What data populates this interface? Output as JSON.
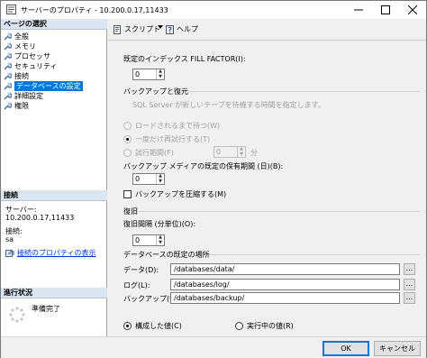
{
  "window": {
    "title": "サーバーのプロパティ - 10.200.0.17,11433"
  },
  "left_pane": {
    "pages_header": "ページの選択",
    "pages": [
      {
        "label": "全般",
        "icon": "wrench-icon",
        "selected": false
      },
      {
        "label": "メモリ",
        "icon": "wrench-icon",
        "selected": false
      },
      {
        "label": "プロセッサ",
        "icon": "wrench-icon",
        "selected": false
      },
      {
        "label": "セキュリティ",
        "icon": "wrench-icon",
        "selected": false
      },
      {
        "label": "接続",
        "icon": "wrench-icon",
        "selected": false
      },
      {
        "label": "データベースの設定",
        "icon": "wrench-icon",
        "selected": true
      },
      {
        "label": "詳細設定",
        "icon": "wrench-icon",
        "selected": false
      },
      {
        "label": "権限",
        "icon": "wrench-icon",
        "selected": false
      }
    ],
    "connection_header": "接続",
    "server_label": "サーバー:",
    "server_value": "10.200.0.17,11433",
    "connection_label": "接続:",
    "connection_value": "sa",
    "view_properties_link": "接続のプロパティの表示",
    "progress_header": "進行状況",
    "progress_status": "準備完了"
  },
  "toolbar": {
    "script_label": "スクリプト",
    "help_label": "ヘルプ"
  },
  "form": {
    "fill_factor_label": "既定のインデックス FILL FACTOR(I):",
    "fill_factor_value": "0",
    "backup_restore_header": "バックアップと復元",
    "tape_prompt_text": "SQL Server が新しいテープを待機する時間を指定します。",
    "wait_indefinitely_label": "ロードされるまで待つ(W)",
    "try_once_label": "一度だけ再試行する(T)",
    "try_minutes_label": "試行期間(F)",
    "try_minutes_value": "0",
    "try_minutes_unit": "分",
    "retention_label": "バックアップ メディアの既定の保有期間 (日)(B):",
    "retention_value": "0",
    "compress_backup_label": "バックアップを圧縮する(M)",
    "recovery_header": "復旧",
    "recovery_interval_label": "復旧間隔 (分単位)(O):",
    "recovery_interval_value": "0",
    "default_locations_header": "データベースの既定の場所",
    "data_label": "データ(D):",
    "data_value": "/databases/data/",
    "log_label": "ログ(L):",
    "log_value": "/databases/log/",
    "backup_label": "バックアップ(U):",
    "backup_value": "/databases/backup/",
    "browse_label": "...",
    "configured_values_label": "構成した値(C)",
    "running_values_label": "実行中の値(R)"
  },
  "buttons": {
    "ok_label": "OK",
    "cancel_label": "キャンセル"
  },
  "colors": {
    "selection": "#0078d7",
    "link": "#0033cc",
    "section_header_bg": "#dce6f2"
  }
}
